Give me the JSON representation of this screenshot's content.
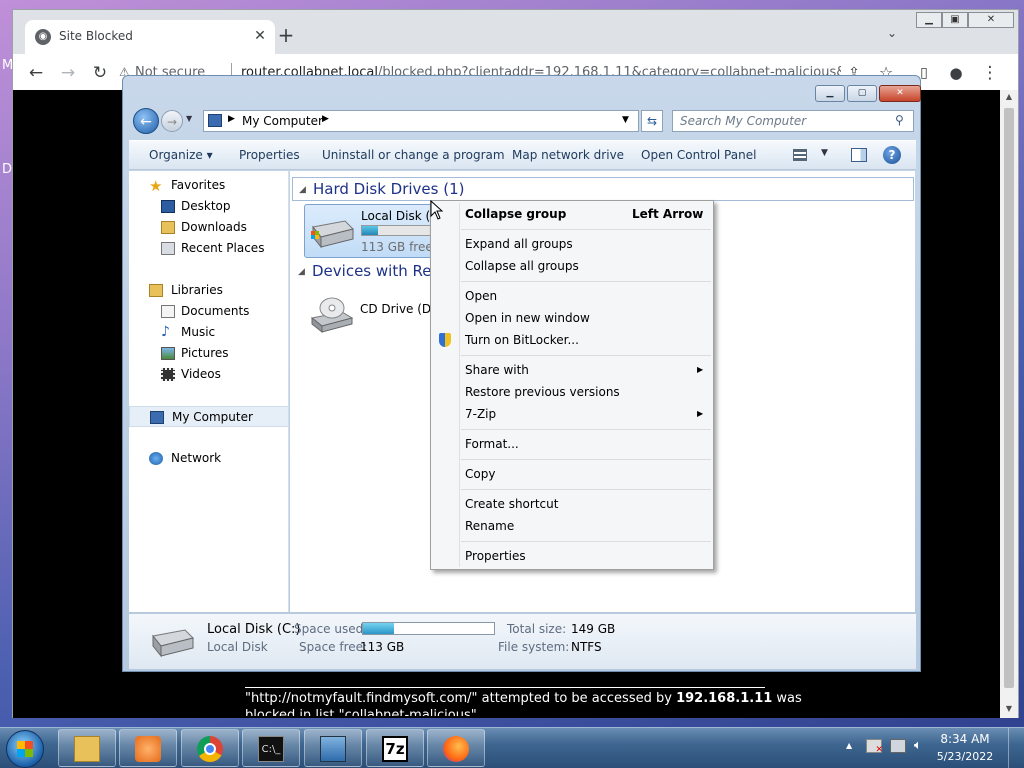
{
  "desktop": {
    "edge_text_1": "M",
    "edge_text_2": "D"
  },
  "browser": {
    "tab_title": "Site Blocked",
    "not_secure": "Not secure",
    "url_host": "router.collabnet.local",
    "url_path": "/blocked.php?clientaddr=192.168.1.11&category=collabnet-malicious&u...",
    "blocked_text": "\"http://notmyfault.findmysoft.com/\" attempted to be accessed by ",
    "blocked_ip": "192.168.1.11",
    "blocked_text_tail": " was",
    "blocked_text_line2": "blocked in list \"collabnet-malicious\""
  },
  "explorer": {
    "address": "My Computer",
    "search_placeholder": "Search My Computer",
    "commands": [
      "Organize ▾",
      "Properties",
      "Uninstall or change a program",
      "Map network drive",
      "Open Control Panel"
    ],
    "nav": {
      "favorites": "Favorites",
      "desktop": "Desktop",
      "downloads": "Downloads",
      "recent": "Recent Places",
      "libraries": "Libraries",
      "documents": "Documents",
      "music": "Music",
      "pictures": "Pictures",
      "videos": "Videos",
      "mycomputer": "My Computer",
      "network": "Network"
    },
    "groups": {
      "hdd": "Hard Disk Drives (1)",
      "removable": "Devices with Remo"
    },
    "drive_c": {
      "name": "Local Disk (C:)",
      "free": "113 GB free of 149 GB",
      "used_fraction": 0.24
    },
    "drive_d": {
      "name": "CD Drive (D:)"
    },
    "details": {
      "name": "Local Disk (C:)",
      "type": "Local Disk",
      "space_used_label": "Space used:",
      "space_free_label": "Space free:",
      "space_free": "113 GB",
      "total_size_label": "Total size:",
      "total_size": "149 GB",
      "file_system_label": "File system:",
      "file_system": "NTFS",
      "used_fraction": 0.24
    }
  },
  "context_menu": {
    "collapse_group": "Collapse group",
    "collapse_shortcut": "Left Arrow",
    "expand_all": "Expand all groups",
    "collapse_all": "Collapse all groups",
    "open": "Open",
    "open_new": "Open in new window",
    "bitlocker": "Turn on BitLocker...",
    "share": "Share with",
    "restore": "Restore previous versions",
    "zip": "7-Zip",
    "format": "Format...",
    "copy": "Copy",
    "shortcut": "Create shortcut",
    "rename": "Rename",
    "properties": "Properties"
  },
  "taskbar": {
    "time": "8:34 AM",
    "date": "5/23/2022",
    "zip_label": "7z"
  }
}
